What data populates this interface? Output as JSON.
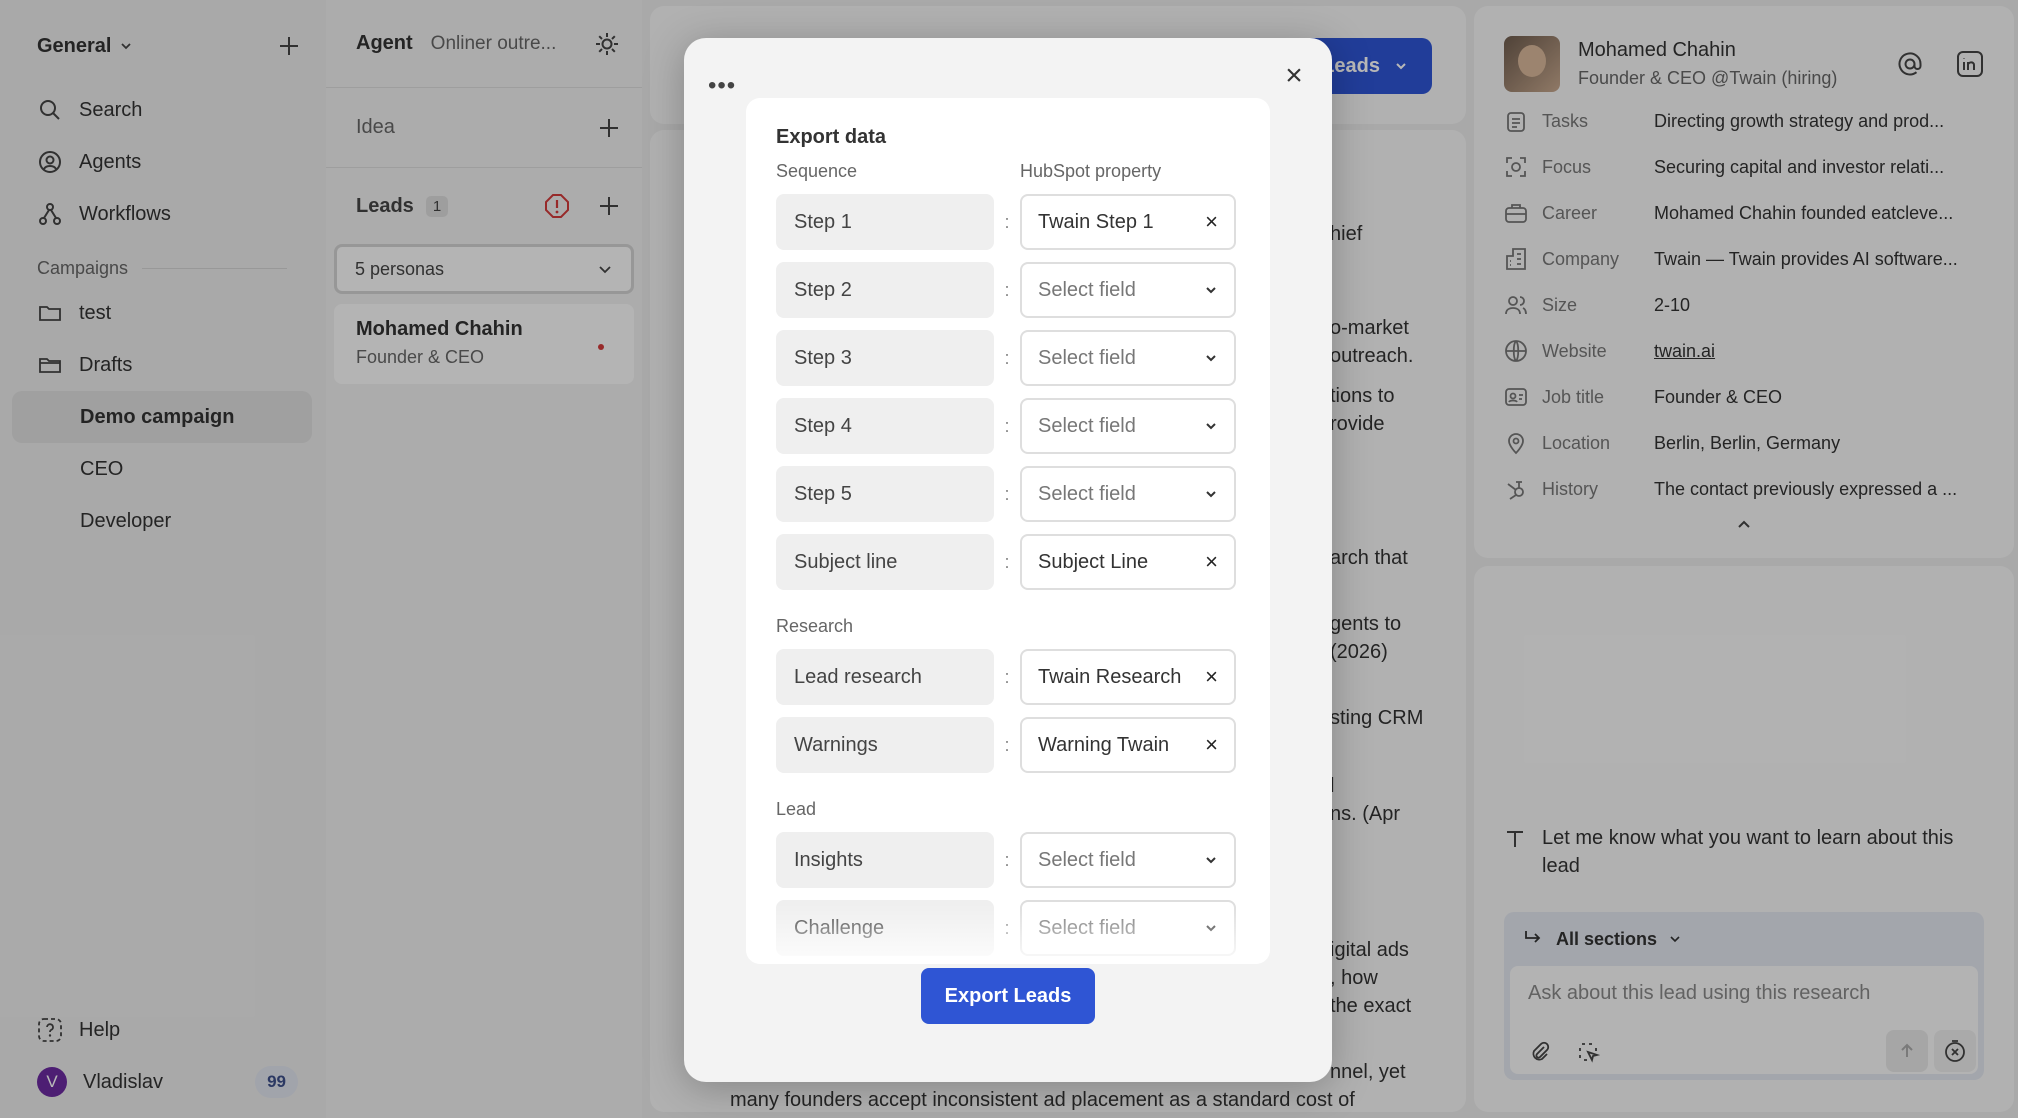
{
  "sidebar": {
    "workspace": "General",
    "nav": [
      {
        "label": "Search",
        "icon": "search-icon"
      },
      {
        "label": "Agents",
        "icon": "agent-icon"
      },
      {
        "label": "Workflows",
        "icon": "workflow-icon"
      }
    ],
    "campaigns_label": "Campaigns",
    "campaigns": [
      {
        "label": "test",
        "icon": "folder-icon"
      },
      {
        "label": "Drafts",
        "icon": "folder-open-icon"
      }
    ],
    "sub_items": [
      "Demo campaign",
      "CEO",
      "Developer"
    ],
    "active_item": "Demo campaign",
    "help": "Help",
    "user": {
      "initial": "V",
      "name": "Vladislav",
      "badge": "99",
      "avatar_color": "#6b2aa0"
    }
  },
  "leads_panel": {
    "agent_label": "Agent",
    "agent_name": "Onliner outre...",
    "idea_label": "Idea",
    "leads_label": "Leads",
    "leads_count": "1",
    "persona_select": "5 personas",
    "lead": {
      "name": "Mohamed Chahin",
      "role": "Founder & CEO"
    }
  },
  "main": {
    "leads_button": "Leads",
    "snippets": [
      "hief",
      "o-market",
      "outreach.",
      "tions to",
      "rovide",
      "arch that",
      "gents to",
      "(2026)",
      "sting CRM",
      "l",
      "ns. (Apr",
      "igital ads",
      ", how",
      "the exact",
      "nnel, yet",
      "many founders accept inconsistent ad placement as a standard cost of"
    ]
  },
  "profile": {
    "name": "Mohamed Chahin",
    "headline": "Founder & CEO @Twain (hiring)",
    "fields": [
      {
        "icon": "clipboard-icon",
        "label": "Tasks",
        "value": "Directing growth strategy and prod..."
      },
      {
        "icon": "focus-icon",
        "label": "Focus",
        "value": "Securing capital and investor relati..."
      },
      {
        "icon": "briefcase-icon",
        "label": "Career",
        "value": "Mohamed Chahin founded eatcleve..."
      },
      {
        "icon": "building-icon",
        "label": "Company",
        "value": "Twain — Twain provides AI software..."
      },
      {
        "icon": "people-icon",
        "label": "Size",
        "value": "2-10"
      },
      {
        "icon": "globe-icon",
        "label": "Website",
        "value": "twain.ai"
      },
      {
        "icon": "id-card-icon",
        "label": "Job title",
        "value": "Founder & CEO"
      },
      {
        "icon": "location-pin-icon",
        "label": "Location",
        "value": "Berlin, Berlin, Germany"
      },
      {
        "icon": "hubspot-icon",
        "label": "History",
        "value": "The contact previously expressed a ..."
      }
    ]
  },
  "chat": {
    "hint": "Let me know what you want to learn about this lead",
    "sections_label": "All sections",
    "placeholder": "Ask about this lead using this research"
  },
  "modal": {
    "title": "Export data",
    "col_source": "Sequence",
    "col_target": "HubSpot property",
    "research_label": "Research",
    "lead_label": "Lead",
    "sequence_rows": [
      {
        "source": "Step 1",
        "target": "Twain Step 1",
        "set": true
      },
      {
        "source": "Step 2",
        "target": "Select field",
        "set": false
      },
      {
        "source": "Step 3",
        "target": "Select field",
        "set": false
      },
      {
        "source": "Step 4",
        "target": "Select field",
        "set": false
      },
      {
        "source": "Step 5",
        "target": "Select field",
        "set": false
      },
      {
        "source": "Subject line",
        "target": "Subject Line",
        "set": true
      }
    ],
    "research_rows": [
      {
        "source": "Lead research",
        "target": "Twain Research",
        "set": true
      },
      {
        "source": "Warnings",
        "target": "Warning Twain",
        "set": true
      }
    ],
    "lead_rows": [
      {
        "source": "Insights",
        "target": "Select field",
        "set": false
      },
      {
        "source": "Challenge",
        "target": "Select field",
        "set": false
      }
    ],
    "export_button": "Export Leads",
    "accent_color": "#2f55d4"
  }
}
